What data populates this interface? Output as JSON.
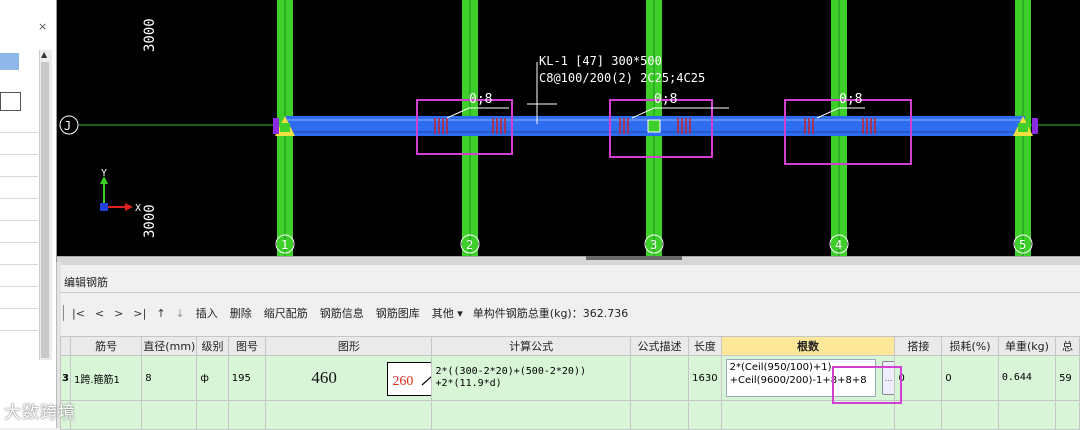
{
  "left_panel": {
    "close_glyph": "×",
    "scroll_arrow": "▲"
  },
  "canvas": {
    "dim_top": "3000",
    "dim_bottom": "3000",
    "axis_row_label": "J",
    "axis_y": "Y",
    "axis_x": "X",
    "axis_columns": [
      "1",
      "2",
      "3",
      "4",
      "5"
    ],
    "beam_annotation_line1": "KL-1 [47] 300*500",
    "beam_annotation_line2": "C8@100/200(2) 2C25;4C25",
    "stirrup_tags": [
      "0;8",
      "0;8",
      "0;8"
    ],
    "colors": {
      "column": "#3ecf2a",
      "beam": "#2e6cf0",
      "highlight": "#d33fd3",
      "stirrup": "#c0283a"
    }
  },
  "edit_panel": {
    "title": "编辑钢筋",
    "toolbar": {
      "nav_first": "|<",
      "nav_prev": "<",
      "nav_next": ">",
      "nav_last": ">|",
      "up": "↑",
      "down": "↓",
      "insert": "插入",
      "delete": "删除",
      "scale_bar": "缩尺配筋",
      "bar_info": "钢筋信息",
      "bar_library": "钢筋图库",
      "other": "其他 ▾",
      "total_label": "单构件钢筋总重(kg)：362.736"
    },
    "columns": [
      "筋号",
      "直径(mm)",
      "级别",
      "图号",
      "图形",
      "计算公式",
      "公式描述",
      "长度",
      "根数",
      "搭接",
      "损耗(%)",
      "单重(kg)",
      "总"
    ],
    "row": {
      "index": "3",
      "bar_no": "1跨.箍筋1",
      "diameter": "8",
      "grade": "ф",
      "shape_no": "195",
      "shape_n1": "460",
      "shape_n2": "260",
      "formula_line1": "2*((300-2*20)+(500-2*20))",
      "formula_line2": "+2*(11.9*d)",
      "formula_desc": "",
      "length": "1630",
      "roots_line1": "2*(Ceil(950/100)+1)",
      "roots_line2": "+Ceil(9600/200)-1+8+8+8",
      "roots_btn": "...",
      "lap": "0",
      "loss": "0",
      "unit_weight": "0.644",
      "total": "59"
    }
  },
  "watermark": "大数跨境"
}
